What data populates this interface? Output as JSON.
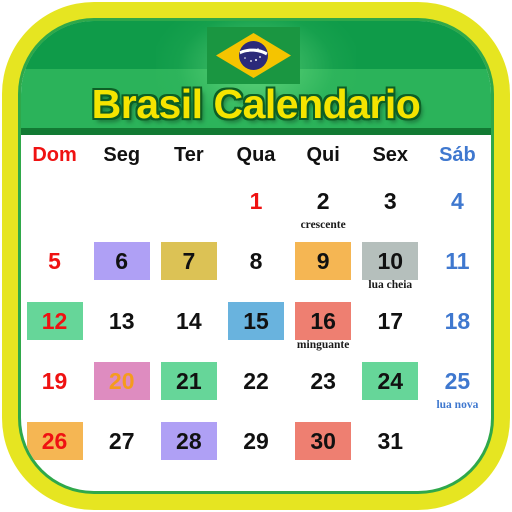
{
  "app": {
    "title": "Brasil Calendario",
    "flag_name": "brazil-flag"
  },
  "colors": {
    "ring_yellow": "#e6e521",
    "header_green": "#2bb35a",
    "header_green_dark": "#0f9b49",
    "title_yellow": "#f5e400",
    "sunday_red": "#ef1212",
    "saturday_blue": "#3f78cf",
    "chip_purple": "#afa0f5",
    "chip_darkyellow": "#dcc255",
    "chip_orange": "#f5b653",
    "chip_gray": "#b5bfbc",
    "chip_green": "#66d699",
    "chip_blue": "#69b3de",
    "chip_salmon": "#ee7f71",
    "chip_pink": "#de8cc0"
  },
  "weekdays": [
    {
      "label": "Dom",
      "tone": "sun"
    },
    {
      "label": "Seg",
      "tone": "normal"
    },
    {
      "label": "Ter",
      "tone": "normal"
    },
    {
      "label": "Qua",
      "tone": "normal"
    },
    {
      "label": "Qui",
      "tone": "normal"
    },
    {
      "label": "Sex",
      "tone": "normal"
    },
    {
      "label": "Sáb",
      "tone": "sat"
    }
  ],
  "weeks": [
    [
      {
        "day": ""
      },
      {
        "day": ""
      },
      {
        "day": ""
      },
      {
        "day": "1",
        "tone": "sun"
      },
      {
        "day": "2",
        "note": "crescente"
      },
      {
        "day": "3"
      },
      {
        "day": "4",
        "tone": "sat"
      }
    ],
    [
      {
        "day": "5",
        "tone": "sun"
      },
      {
        "day": "6",
        "bg": "#afa0f5"
      },
      {
        "day": "7",
        "bg": "#dcc255"
      },
      {
        "day": "8"
      },
      {
        "day": "9",
        "bg": "#f5b653"
      },
      {
        "day": "10",
        "bg": "#b5bfbc",
        "note": "lua cheia"
      },
      {
        "day": "11",
        "tone": "sat"
      }
    ],
    [
      {
        "day": "12",
        "tone": "sun",
        "bg": "#66d699"
      },
      {
        "day": "13"
      },
      {
        "day": "14"
      },
      {
        "day": "15",
        "bg": "#69b3de"
      },
      {
        "day": "16",
        "bg": "#ee7f71",
        "note": "minguante"
      },
      {
        "day": "17"
      },
      {
        "day": "18",
        "tone": "sat"
      }
    ],
    [
      {
        "day": "19",
        "tone": "sun"
      },
      {
        "day": "20",
        "bg": "#de8cc0",
        "color": "#f59b1e"
      },
      {
        "day": "21",
        "bg": "#66d699"
      },
      {
        "day": "22"
      },
      {
        "day": "23"
      },
      {
        "day": "24",
        "bg": "#66d699"
      },
      {
        "day": "25",
        "tone": "sat",
        "note": "lua nova"
      }
    ],
    [
      {
        "day": "26",
        "tone": "sun",
        "bg": "#f5b653"
      },
      {
        "day": "27"
      },
      {
        "day": "28",
        "bg": "#afa0f5"
      },
      {
        "day": "29"
      },
      {
        "day": "30",
        "bg": "#ee7f71"
      },
      {
        "day": "31"
      },
      {
        "day": ""
      }
    ]
  ]
}
